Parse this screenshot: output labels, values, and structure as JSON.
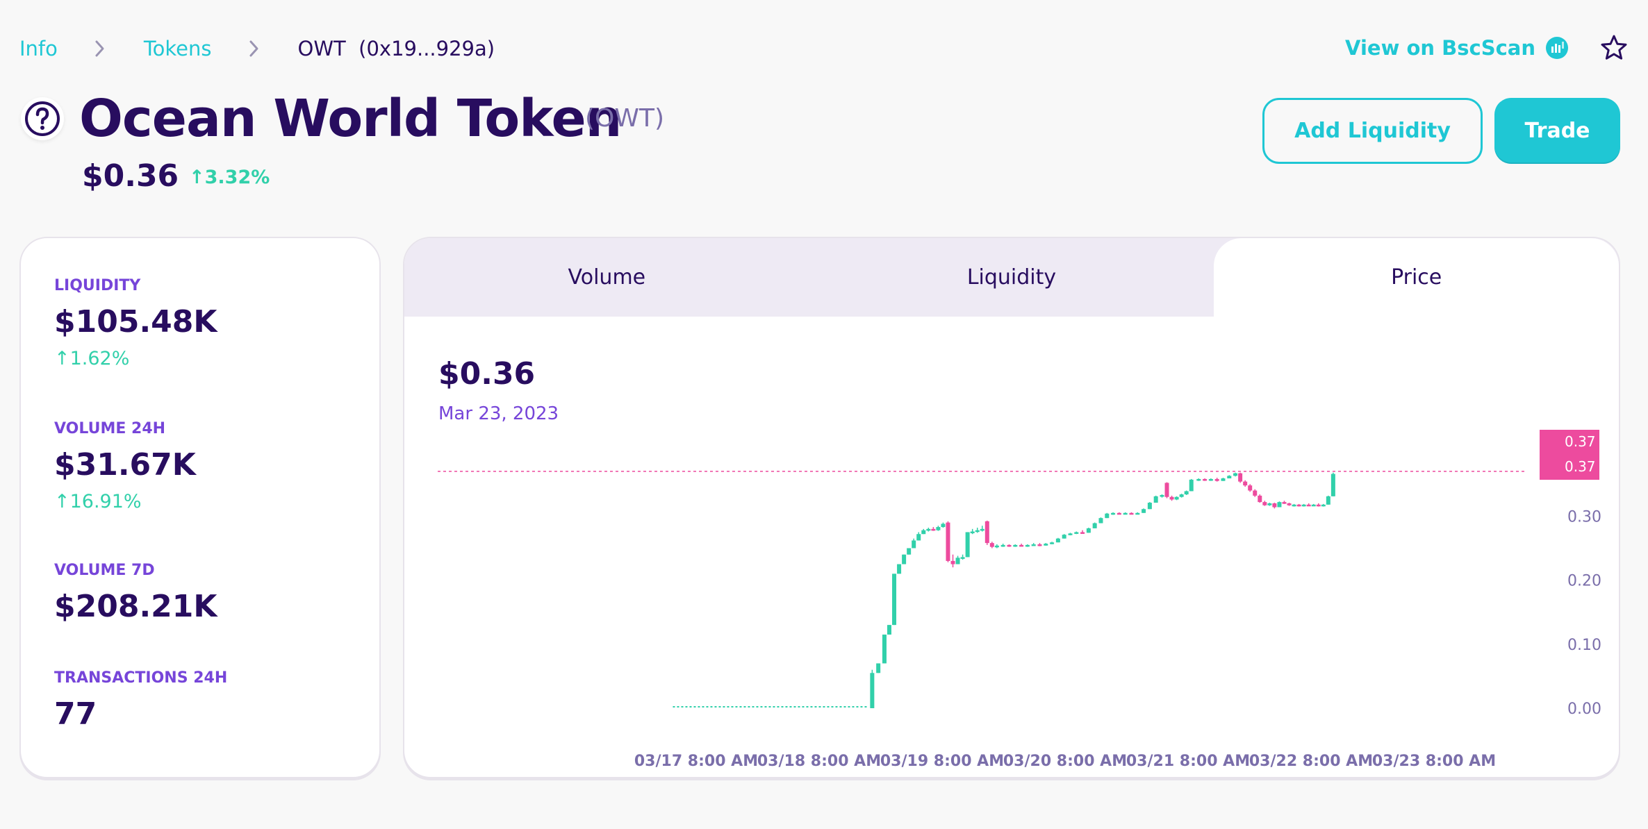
{
  "breadcrumb": {
    "items": [
      "Info",
      "Tokens"
    ],
    "current": "OWT  (0x19...929a)"
  },
  "header": {
    "bscscan_label": "View on BscScan",
    "token_name": "Ocean World Token",
    "token_symbol": "(OWT)",
    "price": "$0.36",
    "change": "↑3.32%"
  },
  "actions": {
    "add_liquidity": "Add Liquidity",
    "trade": "Trade"
  },
  "stats": {
    "liquidity": {
      "label": "LIQUIDITY",
      "value": "$105.48K",
      "change": "↑1.62%"
    },
    "volume_24h": {
      "label": "VOLUME 24H",
      "value": "$31.67K",
      "change": "↑16.91%"
    },
    "volume_7d": {
      "label": "VOLUME 7D",
      "value": "$208.21K"
    },
    "transactions_24h": {
      "label": "TRANSACTIONS 24H",
      "value": "77"
    }
  },
  "chart": {
    "tabs": [
      "Volume",
      "Liquidity",
      "Price"
    ],
    "active_tab": "Price",
    "current_price": "$0.36",
    "date": "Mar 23, 2023"
  },
  "colors": {
    "primary": "#1fc7d4",
    "text": "#280d5f",
    "secondary": "#7645d9",
    "success": "#31d0aa",
    "failure": "#ed4b9e"
  },
  "chart_data": {
    "type": "candlestick",
    "x_ticks": [
      "03/17 8:00 AM",
      "03/18 8:00 AM",
      "03/19 8:00 AM",
      "03/20 8:00 AM",
      "03/21 8:00 AM",
      "03/22 8:00 AM",
      "03/23 8:00 AM"
    ],
    "y_ticks": [
      "0.00",
      "0.10",
      "0.20",
      "0.30"
    ],
    "ylim": [
      0,
      0.37
    ],
    "price_labels": [
      "0.37",
      "0.37"
    ],
    "current_price_line": 0.37,
    "up_color": "#31d0aa",
    "down_color": "#ed4b9e",
    "flat_segment": {
      "from_day": 17.3,
      "to_day": 18.9,
      "price": 0.0
    },
    "candles": [
      {
        "t": 18.93,
        "o": 0.0,
        "h": 0.06,
        "l": 0.0,
        "c": 0.055
      },
      {
        "t": 18.98,
        "o": 0.055,
        "h": 0.07,
        "l": 0.055,
        "c": 0.07
      },
      {
        "t": 19.03,
        "o": 0.07,
        "h": 0.115,
        "l": 0.07,
        "c": 0.115
      },
      {
        "t": 19.07,
        "o": 0.115,
        "h": 0.13,
        "l": 0.115,
        "c": 0.13
      },
      {
        "t": 19.11,
        "o": 0.13,
        "h": 0.21,
        "l": 0.13,
        "c": 0.21
      },
      {
        "t": 19.15,
        "o": 0.21,
        "h": 0.225,
        "l": 0.21,
        "c": 0.225
      },
      {
        "t": 19.19,
        "o": 0.225,
        "h": 0.24,
        "l": 0.225,
        "c": 0.24
      },
      {
        "t": 19.23,
        "o": 0.24,
        "h": 0.25,
        "l": 0.24,
        "c": 0.25
      },
      {
        "t": 19.27,
        "o": 0.25,
        "h": 0.265,
        "l": 0.25,
        "c": 0.262
      },
      {
        "t": 19.31,
        "o": 0.262,
        "h": 0.275,
        "l": 0.262,
        "c": 0.272
      },
      {
        "t": 19.35,
        "o": 0.272,
        "h": 0.28,
        "l": 0.272,
        "c": 0.278
      },
      {
        "t": 19.39,
        "o": 0.278,
        "h": 0.282,
        "l": 0.276,
        "c": 0.28
      },
      {
        "t": 19.43,
        "o": 0.28,
        "h": 0.283,
        "l": 0.277,
        "c": 0.278
      },
      {
        "t": 19.47,
        "o": 0.278,
        "h": 0.285,
        "l": 0.277,
        "c": 0.283
      },
      {
        "t": 19.51,
        "o": 0.283,
        "h": 0.29,
        "l": 0.282,
        "c": 0.288
      },
      {
        "t": 19.55,
        "o": 0.29,
        "h": 0.292,
        "l": 0.228,
        "c": 0.23
      },
      {
        "t": 19.59,
        "o": 0.23,
        "h": 0.24,
        "l": 0.22,
        "c": 0.225
      },
      {
        "t": 19.63,
        "o": 0.225,
        "h": 0.238,
        "l": 0.225,
        "c": 0.235
      },
      {
        "t": 19.67,
        "o": 0.235,
        "h": 0.24,
        "l": 0.232,
        "c": 0.236
      },
      {
        "t": 19.71,
        "o": 0.236,
        "h": 0.275,
        "l": 0.236,
        "c": 0.275
      },
      {
        "t": 19.75,
        "o": 0.275,
        "h": 0.28,
        "l": 0.272,
        "c": 0.276
      },
      {
        "t": 19.79,
        "o": 0.276,
        "h": 0.282,
        "l": 0.274,
        "c": 0.278
      },
      {
        "t": 19.83,
        "o": 0.278,
        "h": 0.285,
        "l": 0.276,
        "c": 0.28
      },
      {
        "t": 19.87,
        "o": 0.292,
        "h": 0.293,
        "l": 0.255,
        "c": 0.258
      },
      {
        "t": 19.91,
        "o": 0.258,
        "h": 0.26,
        "l": 0.25,
        "c": 0.252
      },
      {
        "t": 19.95,
        "o": 0.252,
        "h": 0.256,
        "l": 0.25,
        "c": 0.254
      },
      {
        "t": 20.0,
        "o": 0.254,
        "h": 0.257,
        "l": 0.252,
        "c": 0.255
      },
      {
        "t": 20.05,
        "o": 0.255,
        "h": 0.256,
        "l": 0.252,
        "c": 0.253
      },
      {
        "t": 20.1,
        "o": 0.253,
        "h": 0.256,
        "l": 0.252,
        "c": 0.255
      },
      {
        "t": 20.15,
        "o": 0.255,
        "h": 0.257,
        "l": 0.253,
        "c": 0.254
      },
      {
        "t": 20.2,
        "o": 0.254,
        "h": 0.256,
        "l": 0.252,
        "c": 0.255
      },
      {
        "t": 20.25,
        "o": 0.255,
        "h": 0.258,
        "l": 0.254,
        "c": 0.256
      },
      {
        "t": 20.3,
        "o": 0.256,
        "h": 0.258,
        "l": 0.253,
        "c": 0.254
      },
      {
        "t": 20.35,
        "o": 0.254,
        "h": 0.258,
        "l": 0.254,
        "c": 0.257
      },
      {
        "t": 20.4,
        "o": 0.257,
        "h": 0.26,
        "l": 0.256,
        "c": 0.259
      },
      {
        "t": 20.45,
        "o": 0.259,
        "h": 0.266,
        "l": 0.259,
        "c": 0.265
      },
      {
        "t": 20.5,
        "o": 0.265,
        "h": 0.272,
        "l": 0.265,
        "c": 0.271
      },
      {
        "t": 20.55,
        "o": 0.271,
        "h": 0.274,
        "l": 0.27,
        "c": 0.273
      },
      {
        "t": 20.6,
        "o": 0.273,
        "h": 0.276,
        "l": 0.272,
        "c": 0.275
      },
      {
        "t": 20.65,
        "o": 0.275,
        "h": 0.278,
        "l": 0.273,
        "c": 0.274
      },
      {
        "t": 20.7,
        "o": 0.274,
        "h": 0.282,
        "l": 0.274,
        "c": 0.281
      },
      {
        "t": 20.75,
        "o": 0.281,
        "h": 0.29,
        "l": 0.281,
        "c": 0.289
      },
      {
        "t": 20.8,
        "o": 0.289,
        "h": 0.298,
        "l": 0.289,
        "c": 0.297
      },
      {
        "t": 20.85,
        "o": 0.297,
        "h": 0.305,
        "l": 0.297,
        "c": 0.304
      },
      {
        "t": 20.9,
        "o": 0.304,
        "h": 0.306,
        "l": 0.302,
        "c": 0.305
      },
      {
        "t": 20.95,
        "o": 0.305,
        "h": 0.306,
        "l": 0.303,
        "c": 0.304
      },
      {
        "t": 21.0,
        "o": 0.304,
        "h": 0.306,
        "l": 0.303,
        "c": 0.305
      },
      {
        "t": 21.05,
        "o": 0.305,
        "h": 0.306,
        "l": 0.303,
        "c": 0.304
      },
      {
        "t": 21.1,
        "o": 0.304,
        "h": 0.306,
        "l": 0.303,
        "c": 0.305
      },
      {
        "t": 21.15,
        "o": 0.305,
        "h": 0.312,
        "l": 0.305,
        "c": 0.311
      },
      {
        "t": 21.2,
        "o": 0.311,
        "h": 0.322,
        "l": 0.311,
        "c": 0.321
      },
      {
        "t": 21.25,
        "o": 0.321,
        "h": 0.332,
        "l": 0.321,
        "c": 0.331
      },
      {
        "t": 21.3,
        "o": 0.331,
        "h": 0.334,
        "l": 0.329,
        "c": 0.333
      },
      {
        "t": 21.34,
        "o": 0.352,
        "h": 0.353,
        "l": 0.328,
        "c": 0.33
      },
      {
        "t": 21.38,
        "o": 0.33,
        "h": 0.332,
        "l": 0.324,
        "c": 0.326
      },
      {
        "t": 21.42,
        "o": 0.326,
        "h": 0.331,
        "l": 0.325,
        "c": 0.33
      },
      {
        "t": 21.46,
        "o": 0.33,
        "h": 0.335,
        "l": 0.329,
        "c": 0.334
      },
      {
        "t": 21.5,
        "o": 0.334,
        "h": 0.34,
        "l": 0.333,
        "c": 0.339
      },
      {
        "t": 21.54,
        "o": 0.339,
        "h": 0.358,
        "l": 0.339,
        "c": 0.357
      },
      {
        "t": 21.6,
        "o": 0.357,
        "h": 0.359,
        "l": 0.355,
        "c": 0.358
      },
      {
        "t": 21.65,
        "o": 0.358,
        "h": 0.359,
        "l": 0.355,
        "c": 0.356
      },
      {
        "t": 21.7,
        "o": 0.356,
        "h": 0.359,
        "l": 0.355,
        "c": 0.358
      },
      {
        "t": 21.75,
        "o": 0.358,
        "h": 0.36,
        "l": 0.354,
        "c": 0.355
      },
      {
        "t": 21.8,
        "o": 0.355,
        "h": 0.36,
        "l": 0.355,
        "c": 0.359
      },
      {
        "t": 21.85,
        "o": 0.359,
        "h": 0.364,
        "l": 0.359,
        "c": 0.363
      },
      {
        "t": 21.9,
        "o": 0.363,
        "h": 0.368,
        "l": 0.362,
        "c": 0.367
      },
      {
        "t": 21.94,
        "o": 0.367,
        "h": 0.368,
        "l": 0.352,
        "c": 0.354
      },
      {
        "t": 21.98,
        "o": 0.354,
        "h": 0.356,
        "l": 0.346,
        "c": 0.348
      },
      {
        "t": 22.02,
        "o": 0.348,
        "h": 0.35,
        "l": 0.338,
        "c": 0.34
      },
      {
        "t": 22.06,
        "o": 0.34,
        "h": 0.342,
        "l": 0.33,
        "c": 0.332
      },
      {
        "t": 22.1,
        "o": 0.332,
        "h": 0.334,
        "l": 0.321,
        "c": 0.322
      },
      {
        "t": 22.14,
        "o": 0.322,
        "h": 0.324,
        "l": 0.316,
        "c": 0.317
      },
      {
        "t": 22.18,
        "o": 0.317,
        "h": 0.321,
        "l": 0.316,
        "c": 0.32
      },
      {
        "t": 22.22,
        "o": 0.32,
        "h": 0.321,
        "l": 0.312,
        "c": 0.314
      },
      {
        "t": 22.26,
        "o": 0.314,
        "h": 0.323,
        "l": 0.314,
        "c": 0.322
      },
      {
        "t": 22.3,
        "o": 0.322,
        "h": 0.324,
        "l": 0.319,
        "c": 0.32
      },
      {
        "t": 22.34,
        "o": 0.32,
        "h": 0.321,
        "l": 0.316,
        "c": 0.317
      },
      {
        "t": 22.38,
        "o": 0.317,
        "h": 0.319,
        "l": 0.315,
        "c": 0.318
      },
      {
        "t": 22.42,
        "o": 0.318,
        "h": 0.319,
        "l": 0.315,
        "c": 0.316
      },
      {
        "t": 22.46,
        "o": 0.316,
        "h": 0.319,
        "l": 0.315,
        "c": 0.318
      },
      {
        "t": 22.5,
        "o": 0.318,
        "h": 0.32,
        "l": 0.316,
        "c": 0.317
      },
      {
        "t": 22.54,
        "o": 0.317,
        "h": 0.319,
        "l": 0.316,
        "c": 0.318
      },
      {
        "t": 22.58,
        "o": 0.318,
        "h": 0.32,
        "l": 0.315,
        "c": 0.316
      },
      {
        "t": 22.62,
        "o": 0.316,
        "h": 0.319,
        "l": 0.315,
        "c": 0.318
      },
      {
        "t": 22.66,
        "o": 0.318,
        "h": 0.332,
        "l": 0.318,
        "c": 0.331
      },
      {
        "t": 22.7,
        "o": 0.331,
        "h": 0.368,
        "l": 0.331,
        "c": 0.366
      }
    ]
  }
}
